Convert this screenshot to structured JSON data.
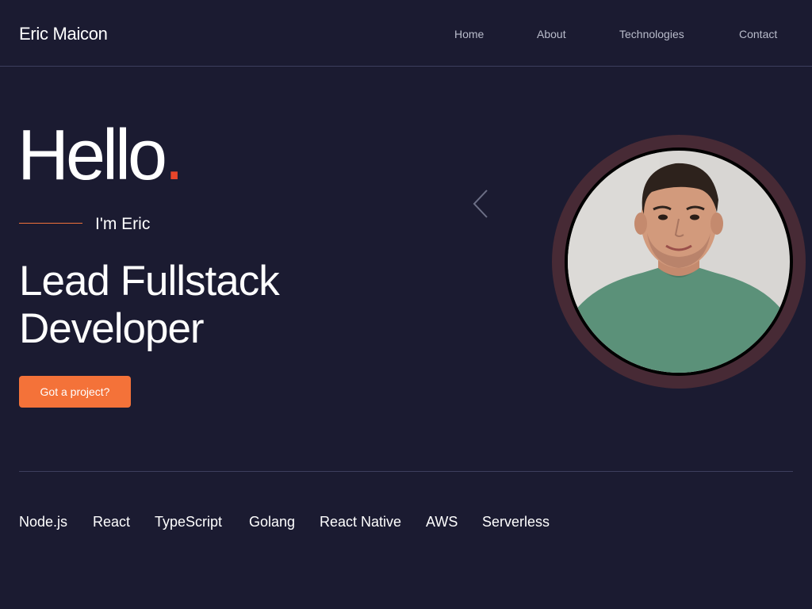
{
  "header": {
    "brand": "Eric Maicon",
    "nav": [
      {
        "label": "Home"
      },
      {
        "label": "About"
      },
      {
        "label": "Technologies"
      },
      {
        "label": "Contact"
      }
    ]
  },
  "hero": {
    "greeting": "Hello",
    "greeting_dot": ".",
    "intro": "I'm Eric",
    "role_line1": "Lead Fullstack",
    "role_line2": "Developer",
    "cta_label": "Got a project?"
  },
  "technologies": [
    "Node.js",
    "React",
    "TypeScript",
    "Golang",
    "React Native",
    "AWS",
    "Serverless"
  ],
  "icons": {
    "carousel_prev": "chevron-left-icon",
    "avatar": "portrait-photo"
  },
  "colors": {
    "background": "#1b1b31",
    "accent": "#f47239",
    "greeting_dot": "#e8452a",
    "avatar_ring": "#472a35",
    "divider": "#3d3e5e",
    "nav_text": "#b9bccb"
  }
}
